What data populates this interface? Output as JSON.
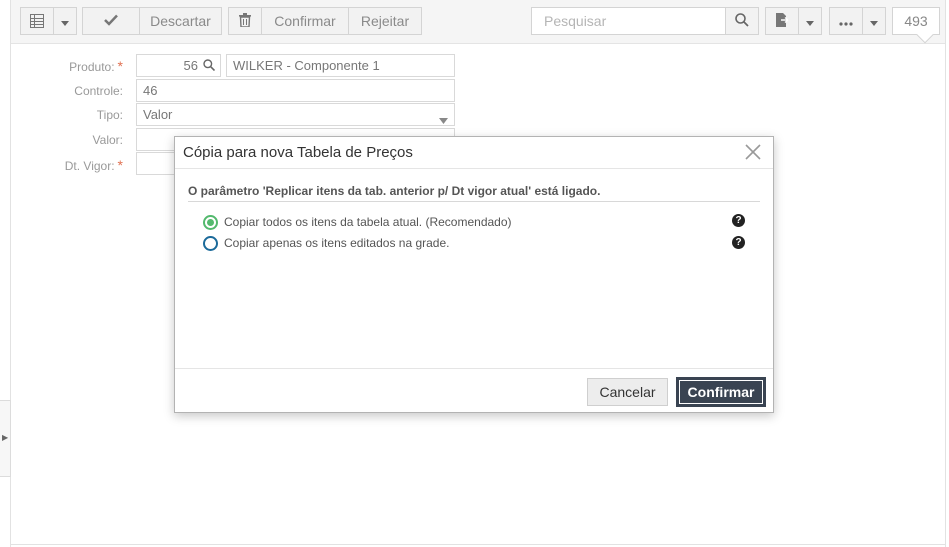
{
  "toolbar": {
    "grid_icon": "grid-icon",
    "check_icon": "check-icon",
    "trash_icon": "trash-icon",
    "discard_label": "Descartar",
    "confirm_label": "Confirmar",
    "reject_label": "Rejeitar",
    "search_placeholder": "Pesquisar",
    "record_count": "493"
  },
  "form": {
    "product_label": "Produto:",
    "product_code": "56",
    "product_name": "WILKER - Componente 1",
    "control_label": "Controle:",
    "control_value": "46",
    "type_label": "Tipo:",
    "type_value": "Valor",
    "value_label": "Valor:",
    "date_label": "Dt. Vigor:",
    "required_mark": "*"
  },
  "modal": {
    "title": "Cópia para nova Tabela de Preços",
    "message": "O parâmetro 'Replicar itens da tab. anterior p/ Dt vigor atual' está ligado.",
    "options": [
      {
        "label": "Copiar todos os itens da tabela atual. (Recomendado)",
        "selected": true
      },
      {
        "label": "Copiar apenas os itens editados na grade.",
        "selected": false
      }
    ],
    "help_glyph": "?",
    "cancel_label": "Cancelar",
    "confirm_label": "Confirmar"
  },
  "colors": {
    "accent_dark": "#3a4452",
    "radio_selected": "#53b96d",
    "radio_unselected": "#1b6a9a",
    "required": "#e07050"
  }
}
